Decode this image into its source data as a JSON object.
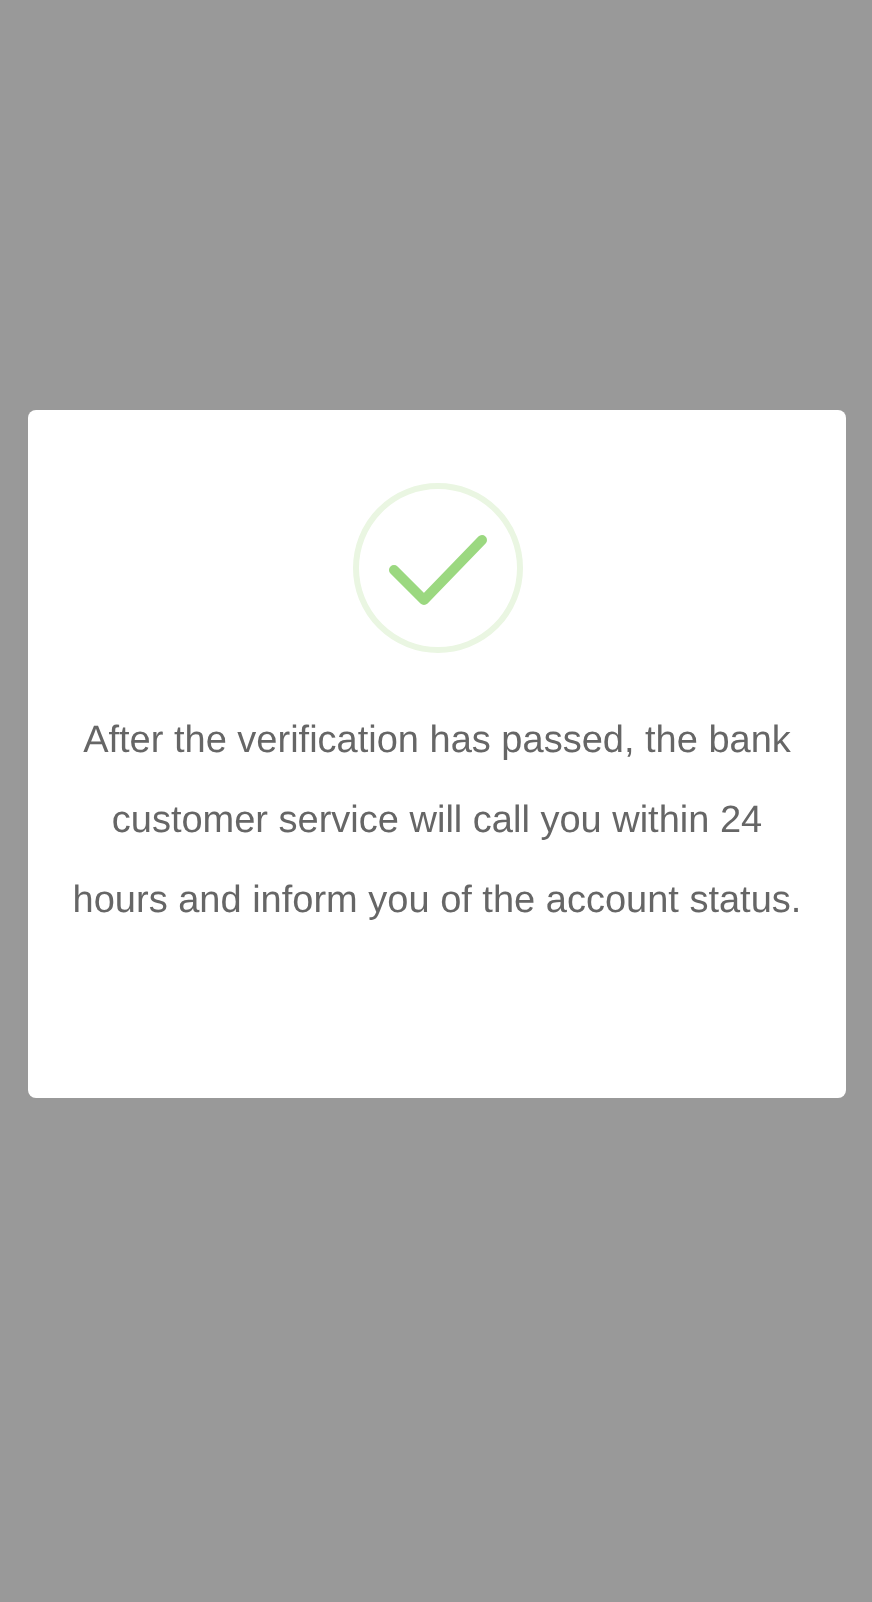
{
  "dialog": {
    "message": "After the verification has passed, the bank customer service will call you within 24 hours and inform you of the account status."
  }
}
